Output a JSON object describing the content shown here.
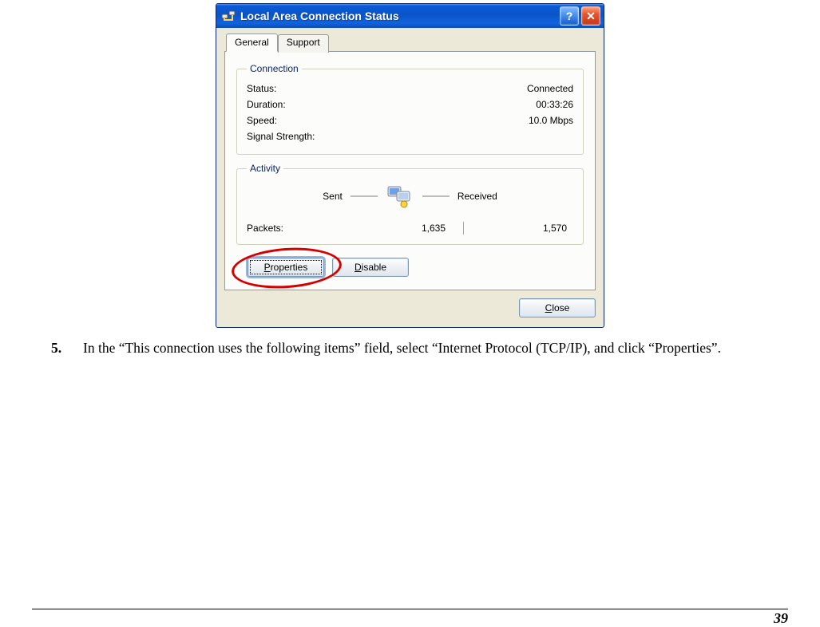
{
  "dialog": {
    "title": "Local Area Connection Status",
    "tabs": {
      "general": "General",
      "support": "Support"
    },
    "connection": {
      "legend": "Connection",
      "status_label": "Status:",
      "status_value": "Connected",
      "duration_label": "Duration:",
      "duration_value": "00:33:26",
      "speed_label": "Speed:",
      "speed_value": "10.0 Mbps",
      "signal_label": "Signal Strength:"
    },
    "activity": {
      "legend": "Activity",
      "sent_label": "Sent",
      "received_label": "Received",
      "packets_label": "Packets:",
      "packets_sent": "1,635",
      "packets_received": "1,570"
    },
    "buttons": {
      "properties": "Properties",
      "disable": "Disable",
      "close": "Close"
    }
  },
  "instruction": {
    "number": "5.",
    "text": "In the “This connection uses the following items” field, select “Internet Protocol (TCP/IP), and click “Properties”."
  },
  "page_number": "39"
}
